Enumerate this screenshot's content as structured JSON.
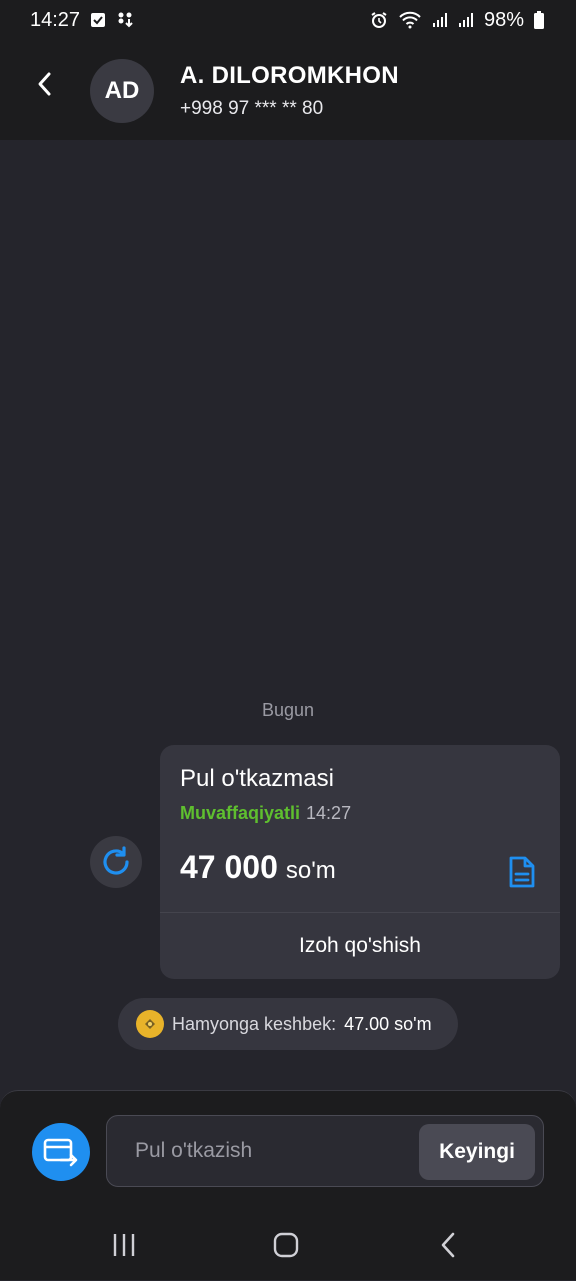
{
  "status_bar": {
    "time": "14:27",
    "battery": "98%",
    "icons": [
      "checkbox-notification-icon",
      "download-notification-icon",
      "alarm-icon",
      "wifi-icon",
      "signal-icon",
      "signal-icon",
      "battery-icon"
    ]
  },
  "header": {
    "avatar_initials": "AD",
    "name": "A. DILOROMKHON",
    "phone": "+998 97 *** ** 80"
  },
  "chat": {
    "date_separator": "Bugun",
    "transaction": {
      "title": "Pul o'tkazmasi",
      "status": "Muvaffaqiyatli",
      "time": "14:27",
      "amount": "47 000",
      "currency": "so'm",
      "comment_action": "Izoh qo'shish"
    },
    "cashback": {
      "label": "Hamyonga keshbek:",
      "value": "47.00 so'm"
    }
  },
  "composer": {
    "placeholder": "Pul o'tkazish",
    "next_label": "Keyingi"
  },
  "colors": {
    "background": "#25252c",
    "bar": "#1c1c1e",
    "card": "#36363f",
    "accent_blue": "#1f8ff0",
    "success_green": "#5fbf2f"
  }
}
